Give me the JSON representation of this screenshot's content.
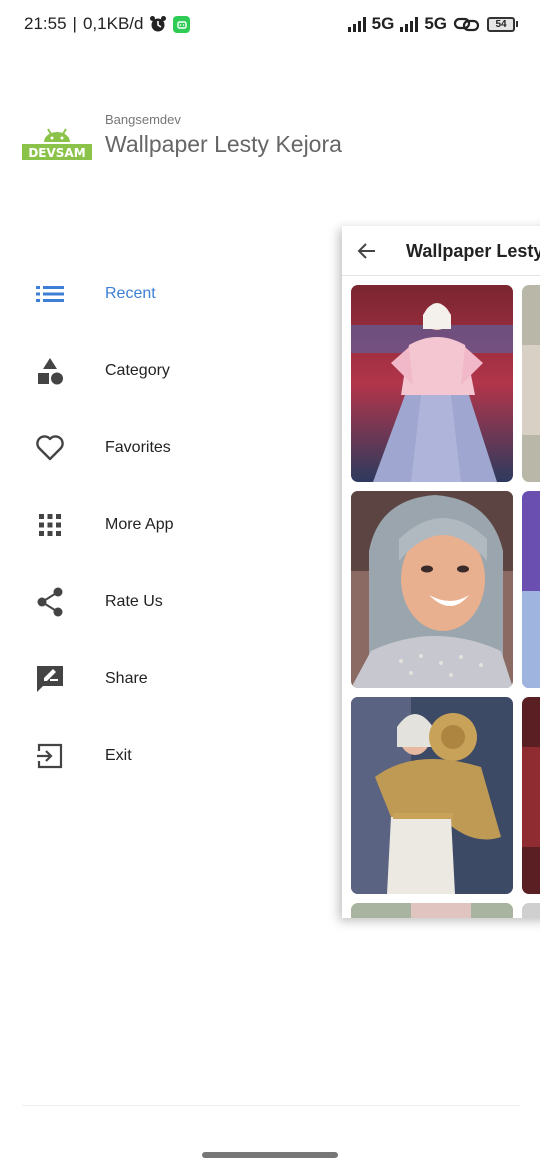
{
  "status_bar": {
    "time": "21:55",
    "separator": "|",
    "network_speed": "0,1KB/d",
    "sim1_type": "5G",
    "sim2_type": "5G",
    "battery_level": "54",
    "icons": [
      "alarm-clock-icon",
      "android-notification-icon",
      "signal-icon",
      "signal-icon",
      "link-icon",
      "battery-icon"
    ]
  },
  "drawer": {
    "logo_text": "DEVSAM",
    "developer": "Bangsemdev",
    "app_title": "Wallpaper Lesty Kejora",
    "accent_color": "#3d7fd6",
    "menu": [
      {
        "label": "Recent",
        "icon": "list-icon",
        "active": true
      },
      {
        "label": "Category",
        "icon": "shapes-icon",
        "active": false
      },
      {
        "label": "Favorites",
        "icon": "heart-icon",
        "active": false
      },
      {
        "label": "More App",
        "icon": "apps-grid-icon",
        "active": false
      },
      {
        "label": "Rate Us",
        "icon": "share-nodes-icon",
        "active": false
      },
      {
        "label": "Share",
        "icon": "feedback-icon",
        "active": false
      },
      {
        "label": "Exit",
        "icon": "exit-icon",
        "active": false
      }
    ]
  },
  "main_screen": {
    "title": "Wallpaper Lesty Kejora",
    "back_icon": "arrow-back-icon"
  }
}
